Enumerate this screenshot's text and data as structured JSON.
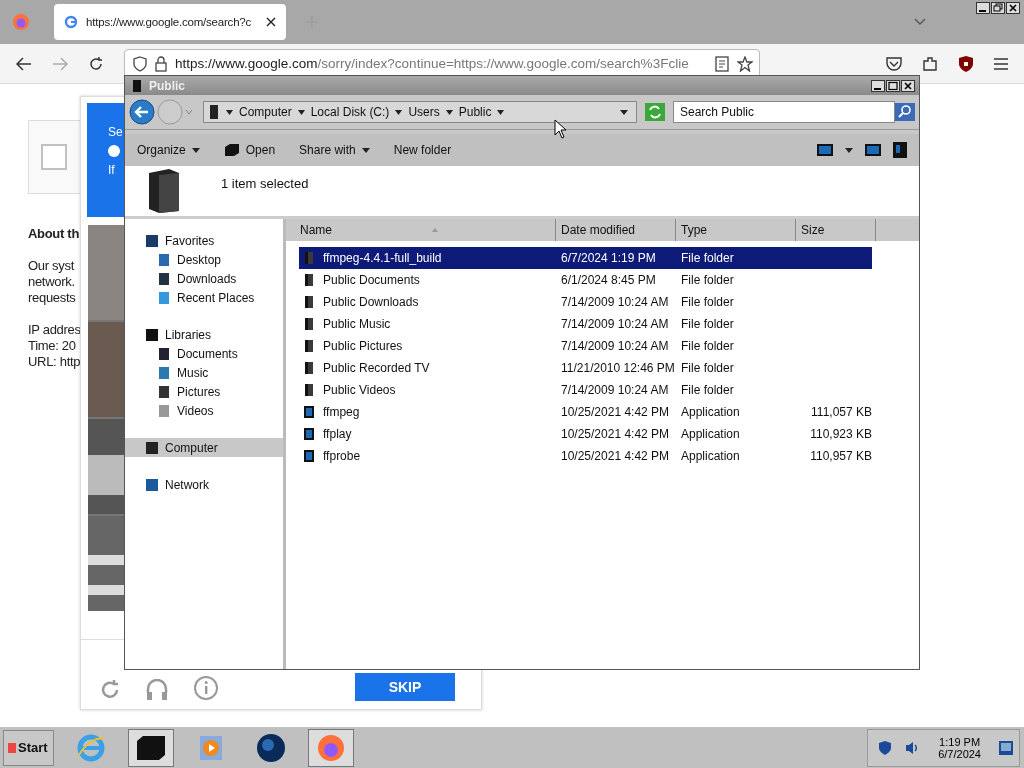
{
  "browser": {
    "tab": {
      "title": "https://www.google.com/search?c",
      "selected": true
    },
    "url": {
      "host": "https://www.google.com",
      "rest": "/sorry/index?continue=https://www.google.com/search%3Fclie"
    }
  },
  "page": {
    "heading": "About th",
    "paragraph": [
      "Our syst",
      "network.",
      "requests"
    ],
    "details": [
      "IP addres",
      "Time: 20",
      "URL: http"
    ],
    "captcha": {
      "header": [
        "Se",
        "If"
      ],
      "skip": "SKIP",
      "checked": false
    }
  },
  "explorer": {
    "title": "Public",
    "breadcrumb": [
      "Computer",
      "Local Disk (C:)",
      "Users",
      "Public"
    ],
    "search": {
      "placeholder": "Search Public"
    },
    "toolbar": [
      {
        "label": "Organize",
        "kind": "menu"
      },
      {
        "label": "Open",
        "kind": "open"
      },
      {
        "label": "Share with",
        "kind": "menu"
      },
      {
        "label": "New folder",
        "kind": "plain"
      }
    ],
    "status": "1 item selected",
    "nav": [
      {
        "label": "Favorites",
        "selected": false,
        "children": [
          {
            "label": "Desktop",
            "selected": false
          },
          {
            "label": "Downloads",
            "selected": false
          },
          {
            "label": "Recent Places",
            "selected": false
          }
        ]
      },
      {
        "label": "Libraries",
        "selected": false,
        "children": [
          {
            "label": "Documents",
            "selected": false
          },
          {
            "label": "Music",
            "selected": false
          },
          {
            "label": "Pictures",
            "selected": false
          },
          {
            "label": "Videos",
            "selected": false
          }
        ]
      },
      {
        "label": "Computer",
        "selected": true
      },
      {
        "label": "Network",
        "selected": false
      }
    ],
    "columns": [
      "Name",
      "Date modified",
      "Type",
      "Size"
    ],
    "rows": [
      {
        "name": "ffmpeg-4.4.1-full_build",
        "date": "6/7/2024 1:19 PM",
        "type": "File folder",
        "kind": "folder",
        "selected": true
      },
      {
        "name": "Public Documents",
        "date": "6/1/2024 8:45 PM",
        "type": "File folder",
        "kind": "folder",
        "selected": false
      },
      {
        "name": "Public Downloads",
        "date": "7/14/2009 10:24 AM",
        "type": "File folder",
        "kind": "folder",
        "selected": false
      },
      {
        "name": "Public Music",
        "date": "7/14/2009 10:24 AM",
        "type": "File folder",
        "kind": "folder",
        "selected": false
      },
      {
        "name": "Public Pictures",
        "date": "7/14/2009 10:24 AM",
        "type": "File folder",
        "kind": "folder",
        "selected": false
      },
      {
        "name": "Public Recorded TV",
        "date": "11/21/2010 12:46 PM",
        "type": "File folder",
        "kind": "folder",
        "selected": false
      },
      {
        "name": "Public Videos",
        "date": "7/14/2009 10:24 AM",
        "type": "File folder",
        "kind": "folder",
        "selected": false
      },
      {
        "name": "ffmpeg",
        "date": "10/25/2021 4:42 PM",
        "type": "Application",
        "size": "111,057 KB",
        "kind": "app",
        "selected": false
      },
      {
        "name": "ffplay",
        "date": "10/25/2021 4:42 PM",
        "type": "Application",
        "size": "110,923 KB",
        "kind": "app",
        "selected": false
      },
      {
        "name": "ffprobe",
        "date": "10/25/2021 4:42 PM",
        "type": "Application",
        "size": "110,957 KB",
        "kind": "app",
        "selected": false
      }
    ]
  },
  "taskbar": {
    "start": "Start",
    "apps": [
      {
        "kind": "ie",
        "selected": false
      },
      {
        "kind": "explorer",
        "selected": true
      },
      {
        "kind": "media",
        "selected": false
      },
      {
        "kind": "globe",
        "selected": false
      },
      {
        "kind": "firefox",
        "selected": true
      }
    ],
    "time": "1:19 PM",
    "date": "6/7/2024"
  }
}
